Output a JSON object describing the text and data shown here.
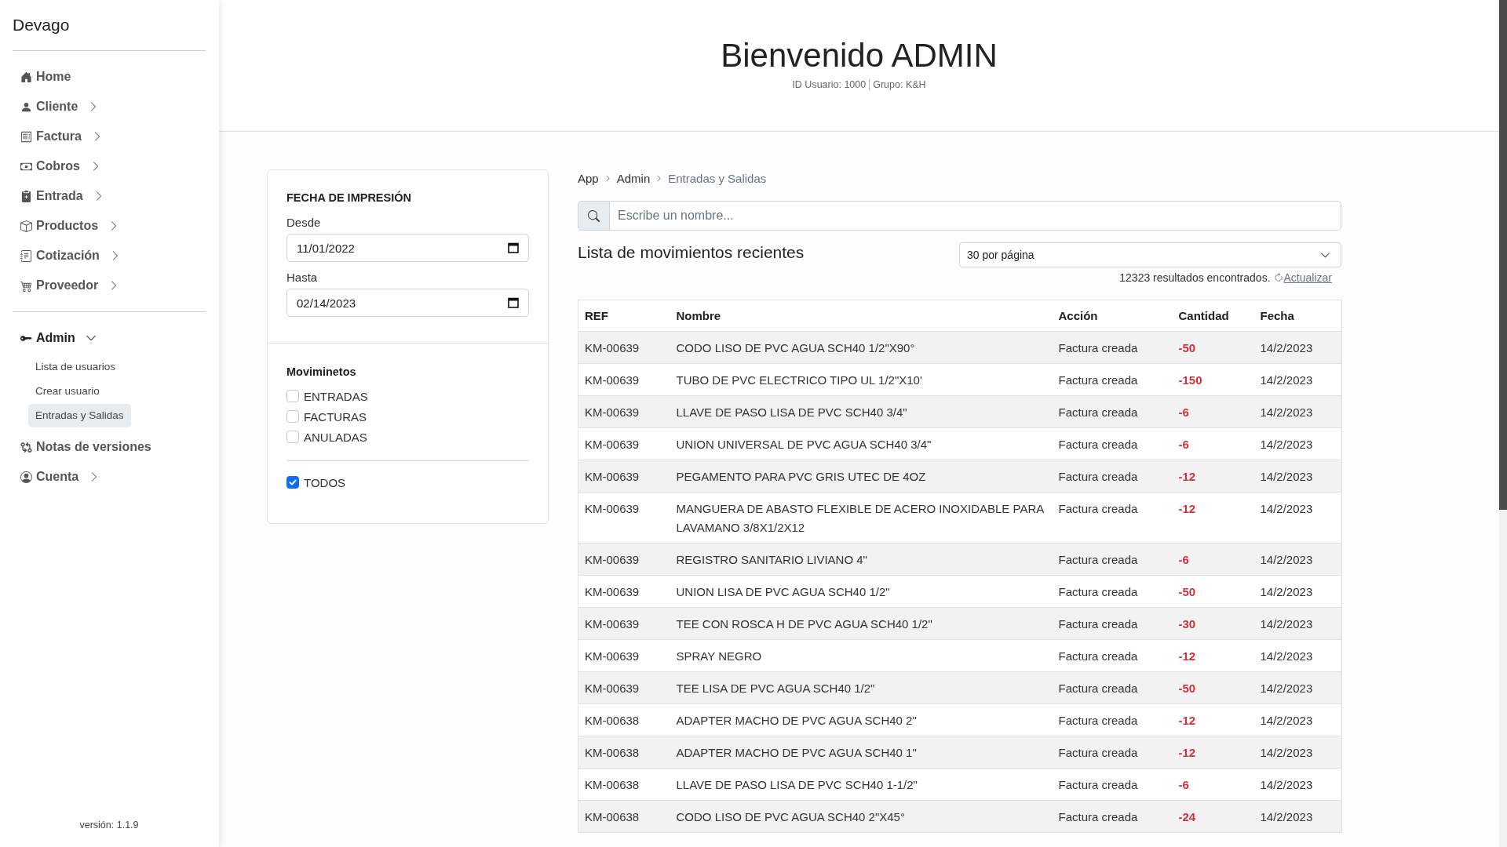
{
  "sidebar": {
    "brand": "Devago",
    "sections": [
      {
        "items": [
          {
            "kind": "link",
            "label": "Home"
          },
          {
            "kind": "group",
            "label": "Cliente",
            "expanded": false
          },
          {
            "kind": "group",
            "label": "Factura",
            "expanded": false
          },
          {
            "kind": "group",
            "label": "Cobros",
            "expanded": false
          },
          {
            "kind": "group",
            "label": "Entrada",
            "expanded": false
          },
          {
            "kind": "group",
            "label": "Productos",
            "expanded": false
          },
          {
            "kind": "group",
            "label": "Cotización",
            "expanded": false
          },
          {
            "kind": "group",
            "label": "Proveedor",
            "expanded": false
          }
        ]
      },
      {
        "items": [
          {
            "kind": "group",
            "label": "Admin",
            "expanded": true,
            "children": [
              {
                "label": "Lista de usuarios",
                "selected": false
              },
              {
                "label": "Crear usuario",
                "selected": false
              },
              {
                "label": "Entradas y Salidas",
                "selected": true
              }
            ]
          },
          {
            "kind": "link",
            "label": "Notas de versiones"
          },
          {
            "kind": "group",
            "label": "Cuenta",
            "expanded": false
          }
        ]
      }
    ],
    "version": "versión: 1.1.9"
  },
  "header": {
    "title": "Bienvenido ADMIN",
    "meta": [
      "ID Usuario: 1000",
      "Grupo: K&H"
    ]
  },
  "filters": {
    "title": "FECHA DE IMPRESIÓN",
    "dates": [
      {
        "label": "Desde",
        "value": "11/01/2022"
      },
      {
        "label": "Hasta",
        "value": "02/14/2023"
      }
    ],
    "movements": {
      "title": "Moviminetos",
      "options": [
        {
          "label": "ENTRADAS",
          "checked": false
        },
        {
          "label": "FACTURAS",
          "checked": false
        },
        {
          "label": "ANULADAS",
          "checked": false
        }
      ],
      "all": {
        "label": "TODOS",
        "checked": true
      }
    }
  },
  "breadcrumb": [
    {
      "label": "App",
      "current": false
    },
    {
      "label": "Admin",
      "current": false
    },
    {
      "label": "Entradas y Salidas",
      "current": true
    }
  ],
  "search": {
    "placeholder": "Escribe un nombre..."
  },
  "list": {
    "title": "Lista de movimientos recientes",
    "page_size": "30 por página",
    "results": "12323 resultados encontrados.",
    "refresh": "Actualizar"
  },
  "table": {
    "columns": [
      "REF",
      "Nombre",
      "Acción",
      "Cantidad",
      "Fecha"
    ],
    "rows": [
      {
        "ref": "KM-00639",
        "name": "CODO LISO DE PVC AGUA SCH40 1/2\"X90°",
        "action": "Factura creada",
        "quantity": "-50",
        "date": "14/2/2023"
      },
      {
        "ref": "KM-00639",
        "name": "TUBO DE PVC ELECTRICO TIPO UL 1/2\"X10'",
        "action": "Factura creada",
        "quantity": "-150",
        "date": "14/2/2023"
      },
      {
        "ref": "KM-00639",
        "name": "LLAVE DE PASO LISA DE PVC SCH40 3/4\"",
        "action": "Factura creada",
        "quantity": "-6",
        "date": "14/2/2023"
      },
      {
        "ref": "KM-00639",
        "name": "UNION UNIVERSAL DE PVC AGUA SCH40 3/4\"",
        "action": "Factura creada",
        "quantity": "-6",
        "date": "14/2/2023"
      },
      {
        "ref": "KM-00639",
        "name": "PEGAMENTO PARA PVC GRIS UTEC DE 4OZ",
        "action": "Factura creada",
        "quantity": "-12",
        "date": "14/2/2023"
      },
      {
        "ref": "KM-00639",
        "name": "MANGUERA DE ABASTO FLEXIBLE DE ACERO INOXIDABLE PARA LAVAMANO 3/8X1/2X12",
        "action": "Factura creada",
        "quantity": "-12",
        "date": "14/2/2023"
      },
      {
        "ref": "KM-00639",
        "name": "REGISTRO SANITARIO LIVIANO 4\"",
        "action": "Factura creada",
        "quantity": "-6",
        "date": "14/2/2023"
      },
      {
        "ref": "KM-00639",
        "name": "UNION LISA DE PVC AGUA SCH40 1/2\"",
        "action": "Factura creada",
        "quantity": "-50",
        "date": "14/2/2023"
      },
      {
        "ref": "KM-00639",
        "name": "TEE CON ROSCA H DE PVC AGUA SCH40 1/2\"",
        "action": "Factura creada",
        "quantity": "-30",
        "date": "14/2/2023"
      },
      {
        "ref": "KM-00639",
        "name": "SPRAY NEGRO",
        "action": "Factura creada",
        "quantity": "-12",
        "date": "14/2/2023"
      },
      {
        "ref": "KM-00639",
        "name": "TEE LISA DE PVC AGUA SCH40 1/2\"",
        "action": "Factura creada",
        "quantity": "-50",
        "date": "14/2/2023"
      },
      {
        "ref": "KM-00638",
        "name": "ADAPTER MACHO DE PVC AGUA SCH40 2\"",
        "action": "Factura creada",
        "quantity": "-12",
        "date": "14/2/2023"
      },
      {
        "ref": "KM-00638",
        "name": "ADAPTER MACHO DE PVC AGUA SCH40 1\"",
        "action": "Factura creada",
        "quantity": "-12",
        "date": "14/2/2023"
      },
      {
        "ref": "KM-00638",
        "name": "LLAVE DE PASO LISA DE PVC SCH40 1-1/2\"",
        "action": "Factura creada",
        "quantity": "-6",
        "date": "14/2/2023"
      },
      {
        "ref": "KM-00638",
        "name": "CODO LISO DE PVC AGUA SCH40 2\"X45°",
        "action": "Factura creada",
        "quantity": "-24",
        "date": "14/2/2023"
      }
    ]
  }
}
